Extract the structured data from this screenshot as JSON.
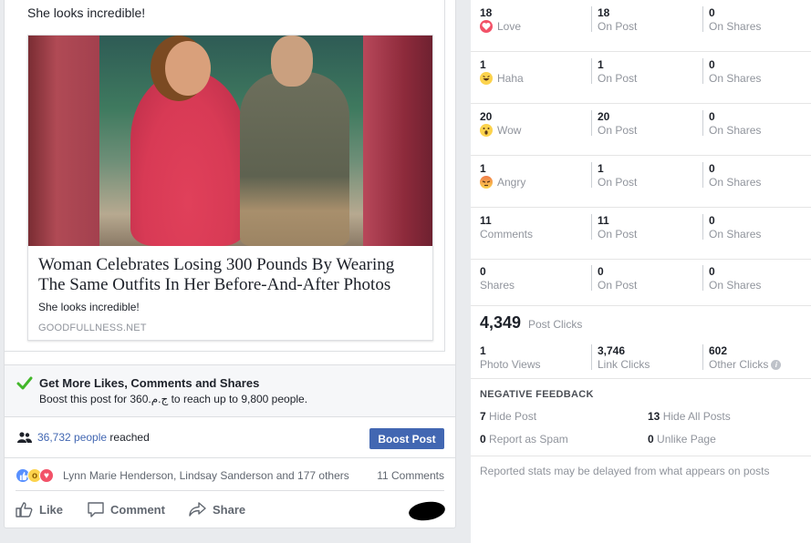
{
  "post": {
    "text": "She looks incredible!",
    "link": {
      "title": "Woman Celebrates Losing 300 Pounds By Wearing The Same Outfits In Her Before-And-After Photos",
      "description": "She looks incredible!",
      "domain": "GOODFULLNESS.NET"
    }
  },
  "boost_promo": {
    "title": "Get More Likes, Comments and Shares",
    "subtitle": "Boost this post for 360.ج.م to reach up to 9,800 people."
  },
  "reach": {
    "count": "36,732 people",
    "suffix": " reached",
    "boost_button": "Boost Post"
  },
  "reactions": {
    "names": "Lynn Marie Henderson, Lindsay Sanderson and 177 others",
    "comments": "11 Comments"
  },
  "actions": {
    "like": "Like",
    "comment": "Comment",
    "share": "Share"
  },
  "stats": {
    "rows": [
      {
        "total": "18",
        "label": "Love",
        "icon": "love",
        "on_post": "18",
        "on_post_label": "On Post",
        "on_shares": "0",
        "on_shares_label": "On Shares"
      },
      {
        "total": "1",
        "label": "Haha",
        "icon": "haha",
        "on_post": "1",
        "on_post_label": "On Post",
        "on_shares": "0",
        "on_shares_label": "On Shares"
      },
      {
        "total": "20",
        "label": "Wow",
        "icon": "wow",
        "on_post": "20",
        "on_post_label": "On Post",
        "on_shares": "0",
        "on_shares_label": "On Shares"
      },
      {
        "total": "1",
        "label": "Angry",
        "icon": "angry",
        "on_post": "1",
        "on_post_label": "On Post",
        "on_shares": "0",
        "on_shares_label": "On Shares"
      },
      {
        "total": "11",
        "label": "Comments",
        "icon": "",
        "on_post": "11",
        "on_post_label": "On Post",
        "on_shares": "0",
        "on_shares_label": "On Shares"
      },
      {
        "total": "0",
        "label": "Shares",
        "icon": "",
        "on_post": "0",
        "on_post_label": "On Post",
        "on_shares": "0",
        "on_shares_label": "On Shares"
      }
    ],
    "post_clicks": {
      "total": "4,349",
      "label": "Post Clicks",
      "photo_views": "1",
      "photo_views_label": "Photo Views",
      "link_clicks": "3,746",
      "link_clicks_label": "Link Clicks",
      "other_clicks": "602",
      "other_clicks_label": "Other Clicks"
    },
    "negative": {
      "title": "NEGATIVE FEEDBACK",
      "hide_post": "7",
      "hide_post_label": "Hide Post",
      "hide_all": "13",
      "hide_all_label": "Hide All Posts",
      "spam": "0",
      "spam_label": "Report as Spam",
      "unlike": "0",
      "unlike_label": "Unlike Page"
    },
    "note": "Reported stats may be delayed from what appears on posts"
  },
  "colors": {
    "accent": "#4267b2",
    "muted": "#90949c",
    "promo_check": "#42b72a"
  }
}
